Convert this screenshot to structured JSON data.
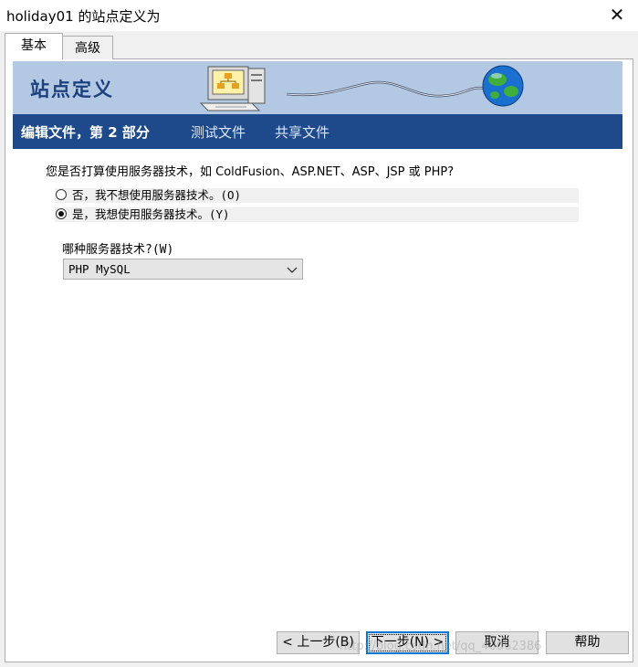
{
  "window": {
    "title": "holiday01 的站点定义为",
    "close_glyph": "✕"
  },
  "tabs": [
    {
      "label": "基本",
      "active": true
    },
    {
      "label": "高级",
      "active": false
    }
  ],
  "banner": {
    "title": "站点定义"
  },
  "steps": [
    {
      "label": "编辑文件，第 2 部分",
      "current": true
    },
    {
      "label": "测试文件",
      "current": false
    },
    {
      "label": "共享文件",
      "current": false
    }
  ],
  "form": {
    "question": "您是否打算使用服务器技术，如 ColdFusion、ASP.NET、ASP、JSP 或 PHP?",
    "options": [
      {
        "label": "否，我不想使用服务器技术。(O)",
        "selected": false
      },
      {
        "label": "是，我想使用服务器技术。(Y)",
        "selected": true
      }
    ],
    "server_tech_label": "哪种服务器技术?(W)",
    "server_tech_value": "PHP MySQL"
  },
  "buttons": {
    "back": "< 上一步(B)",
    "next": "下一步(N) >",
    "cancel": "取消",
    "help": "帮助"
  },
  "watermark": "http://blog.csdn.net/qq_40062386",
  "colors": {
    "banner_bg": "#b3c9e3",
    "banner_title": "#1c3f7e",
    "stepbar_bg": "#1e4a8c",
    "focus_border": "#0078d7"
  }
}
